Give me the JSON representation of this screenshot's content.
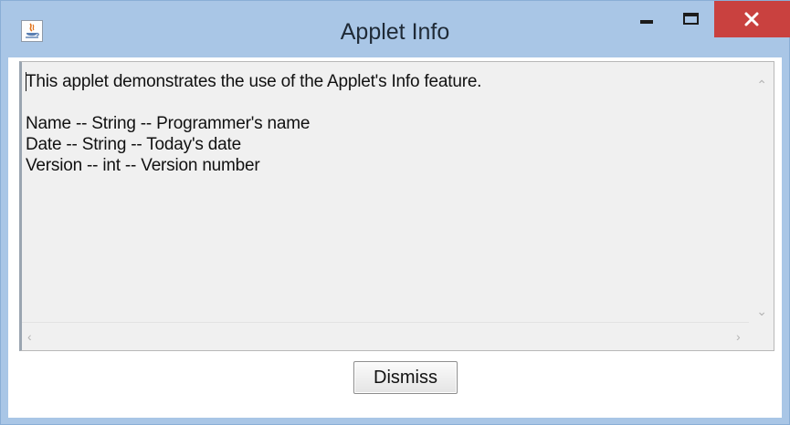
{
  "window": {
    "title": "Applet Info",
    "app_icon": "java-icon",
    "controls": {
      "minimize_icon": "minimize-icon",
      "maximize_icon": "maximize-icon",
      "close_icon": "close-icon",
      "close_color": "#c9413f"
    },
    "frame_color": "#a9c6e6"
  },
  "info_text": {
    "line1": "This applet demonstrates the use of the Applet's Info feature.",
    "line2": "",
    "line3": "Name -- String -- Programmer's name",
    "line4": "Date -- String -- Today's date",
    "line5": "Version -- int -- Version number"
  },
  "scrollbars": {
    "up_icon": "chevron-up-icon",
    "down_icon": "chevron-down-icon",
    "left_icon": "chevron-left-icon",
    "right_icon": "chevron-right-icon"
  },
  "buttons": {
    "dismiss_label": "Dismiss"
  }
}
